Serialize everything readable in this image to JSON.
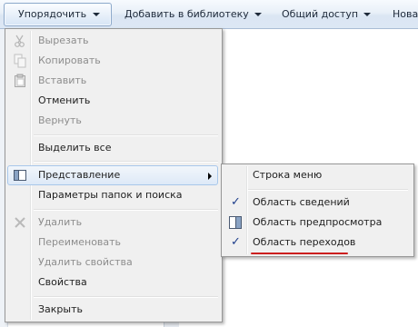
{
  "commandbar": {
    "organize": "Упорядочить",
    "add_to_library": "Добавить в библиотеку",
    "share": "Общий доступ",
    "new_folder_partial": "Нова"
  },
  "menu": {
    "cut": "Вырезать",
    "copy": "Копировать",
    "paste": "Вставить",
    "undo": "Отменить",
    "redo": "Вернуть",
    "select_all": "Выделить все",
    "layout": "Представление",
    "folder_options": "Параметры папок и поиска",
    "delete": "Удалить",
    "rename": "Переименовать",
    "remove_properties": "Удалить свойства",
    "properties": "Свойства",
    "close": "Закрыть"
  },
  "submenu": {
    "menu_bar": "Строка меню",
    "details_pane": "Область сведений",
    "preview_pane": "Область предпросмотра",
    "navigation_pane": "Область переходов",
    "check_glyph": "✓"
  },
  "colors": {
    "accent_red": "#cc1f1f",
    "hover_border": "#a8c7ea"
  }
}
